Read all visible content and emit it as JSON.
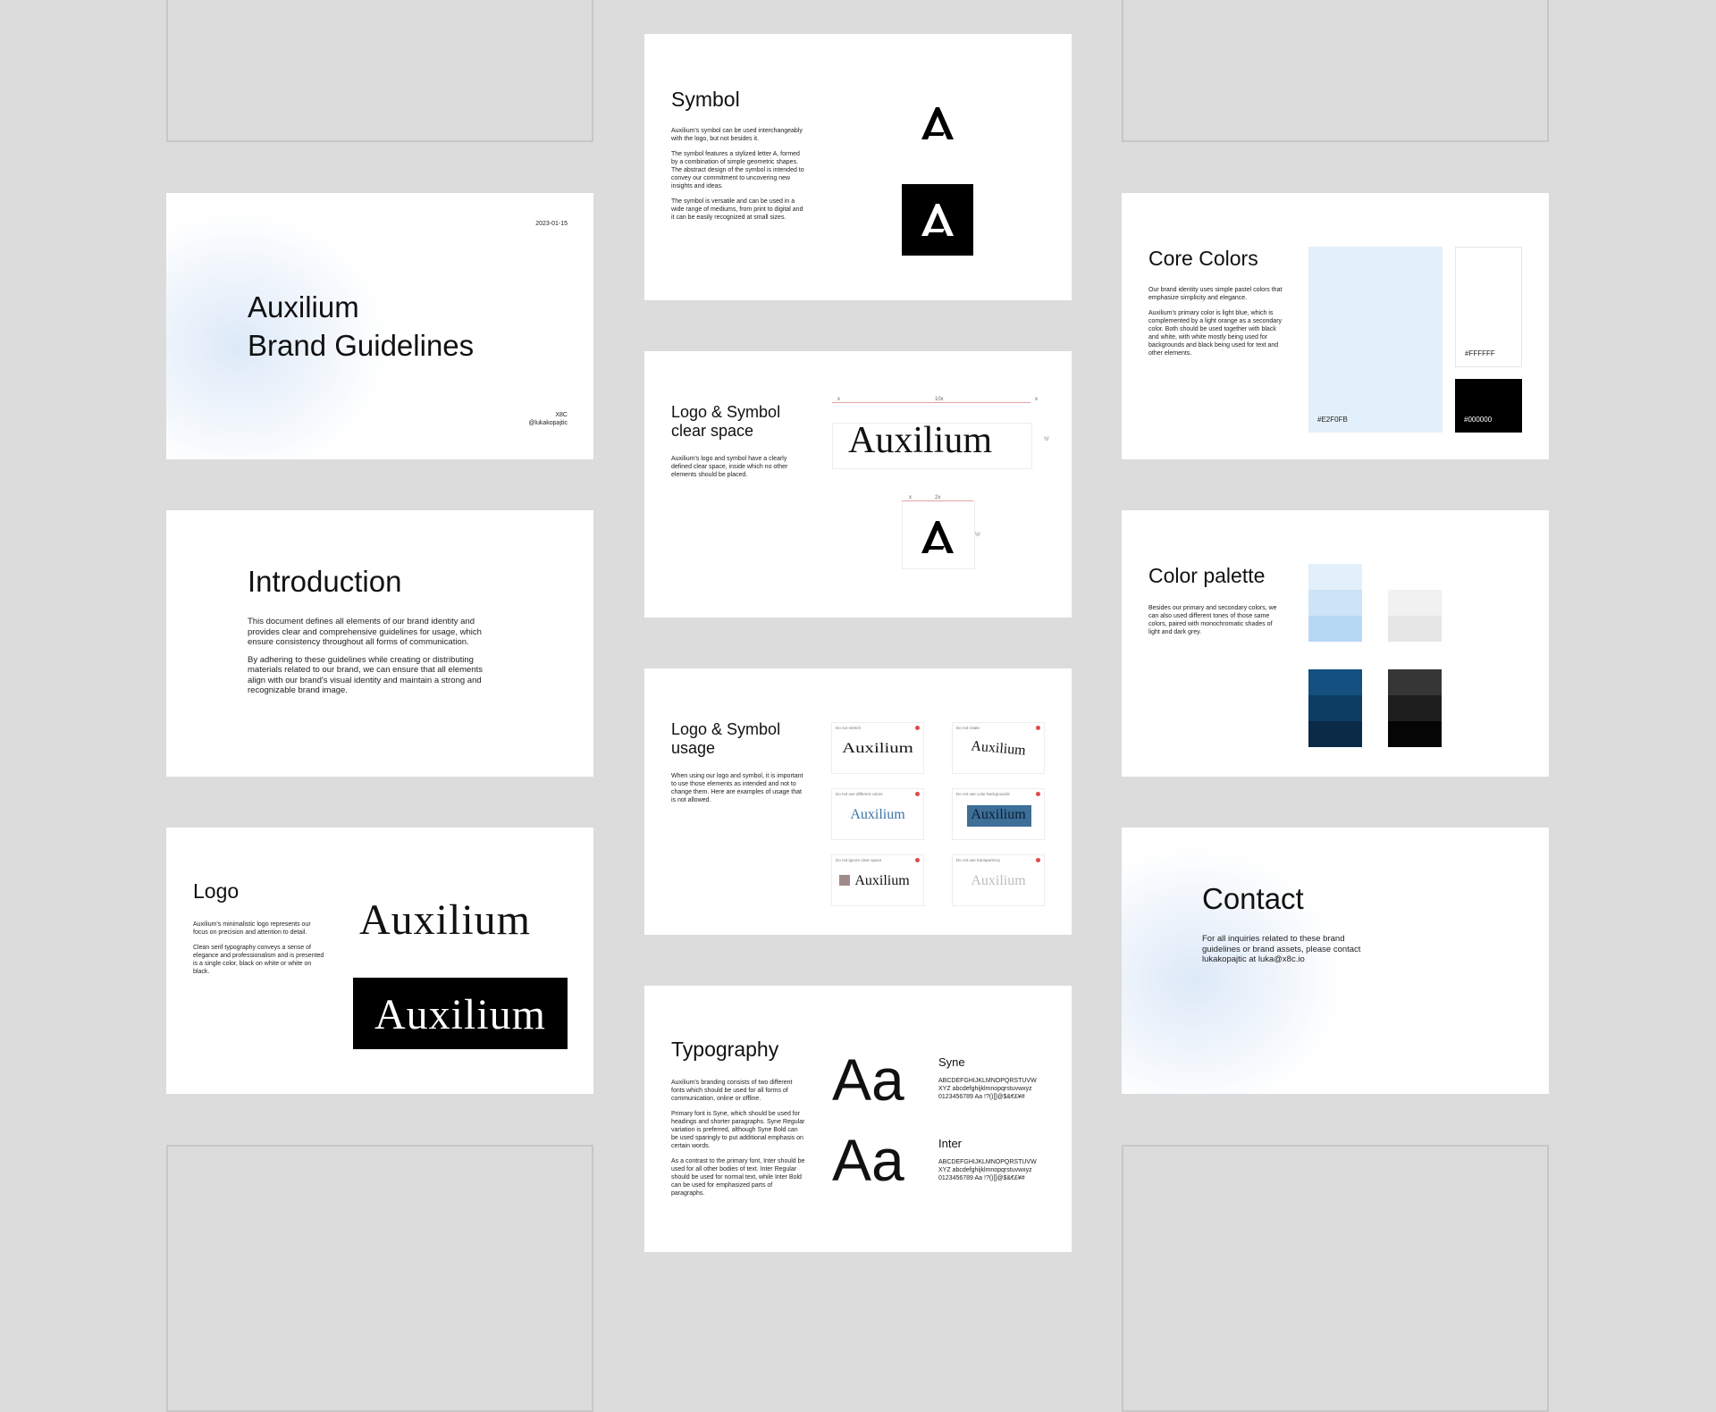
{
  "title_slide": {
    "date": "2023-01-15",
    "title_line1": "Auxilium",
    "title_line2": "Brand Guidelines",
    "author_org": "X8C",
    "author_handle": "@lukakopajtic"
  },
  "intro_slide": {
    "title": "Introduction",
    "para1": "This document defines all elements of our brand identity and provides clear and comprehensive guidelines for usage, which ensure consistency throughout all forms of communication.",
    "para2": "By adhering to these guidelines while creating or distributing materials related to our brand, we can ensure that all elements align with our brand's visual identity and maintain a strong and recognizable brand image."
  },
  "logo_slide": {
    "title": "Logo",
    "para1": "Auxilium's minimalistic logo represents our focus on precision and attention to detail.",
    "para2": "Clean serif typography conveys a sense of elegance and professionalism and is presented is a single color, black on white or white on black.",
    "wordmark": "Auxilium"
  },
  "symbol_slide": {
    "title": "Symbol",
    "para1": "Auxilium's symbol can be used interchangeably with the logo, but not besides it.",
    "para2": "The symbol features a stylized letter A, formed by a combination of simple geometric shapes. The abstract design of the symbol is intended to convey our commitment to uncovering new insights and ideas.",
    "para3": "The symbol is versatile and can be used in a wide range of mediums, from print to digital and it can be easily recognized at small sizes."
  },
  "clearspace_slide": {
    "title_line1": "Logo & Symbol",
    "title_line2": "clear space",
    "para1": "Auxilium's logo and symbol have a clearly defined clear space, inside which no other elements should be placed.",
    "wordmark": "Auxilium",
    "mark_x": "x",
    "mark_10x": "10x",
    "mark_2x": "2x",
    "mark_y": "½'"
  },
  "usage_slide": {
    "title_line1": "Logo & Symbol",
    "title_line2": "usage",
    "para1": "When using our logo and symbol, it is important to use those elements as intended and not to change them. Here are examples of usage that is not allowed.",
    "cards": [
      {
        "caption": "Do not stretch",
        "word": "Auxilium"
      },
      {
        "caption": "Do not rotate",
        "word": "Auxilium"
      },
      {
        "caption": "Do not use different colors",
        "word": "Auxilium"
      },
      {
        "caption": "Do not use color backgrounds",
        "word": "Auxilium"
      },
      {
        "caption": "Do not ignore clear space",
        "word": "Auxilium"
      },
      {
        "caption": "Do not use transparency",
        "word": "Auxilium"
      }
    ]
  },
  "typography_slide": {
    "title": "Typography",
    "para1": "Auxilium's branding consists of two different fonts which should be used for all forms of communication, online or offline.",
    "para2": "Primary font is Syne, which should be used for headings and shorter paragraphs. Syne Regular variation is preferred, although Syne Bold can be used sparingly to put additional emphasis on certain words.",
    "para3": "As a contrast to the primary font, Inter should be used for all other bodies of text. Inter Regular should be used for normal text, while Inter Bold can be used for emphasized parts of paragraphs.",
    "sample": "Aa",
    "font1_name": "Syne",
    "font1_line1": "ABCDEFGHIJKLMNOPQRSTUVW",
    "font1_line2": "XYZ abcdefghijklmnopqrstuvwxyz",
    "font1_line3": "0123456789 Aa !?()[]@$&€£¥#",
    "font2_name": "Inter",
    "font2_line1": "ABCDEFGHIJKLMNOPQRSTUVW",
    "font2_line2": "XYZ abcdefghijklmnopqrstuvwxyz",
    "font2_line3": "0123456789 Aa !?()[]@$&€£¥#"
  },
  "core_colors_slide": {
    "title": "Core Colors",
    "para1": "Our brand identity uses simple pastel colors that emphasize simplicity and elegance.",
    "para2": "Auxilium's primary color is light blue, which is complemented by a light orange as a secondary color. Both should be used together with black and white, with white mostly being used for backgrounds and black being used for text and other elements.",
    "primary_label": "#E2F0FB",
    "white_label": "#FFFFFF",
    "black_label": "#000000",
    "colors": {
      "primary": "#E2F0FB",
      "white": "#FFFFFF",
      "black": "#000000"
    }
  },
  "palette_slide": {
    "title": "Color palette",
    "para1": "Besides our primary and secondary colors, we can also used different tones of those same colors, paired with monochromatic shades of light and dark grey.",
    "light_blues": [
      "#E2F0FB",
      "#CDE3F7",
      "#B7D8F4"
    ],
    "light_greys": [
      "#F1F1F1",
      "#E6E6E6"
    ],
    "dark_blues": [
      "#13507F",
      "#0E3D63",
      "#0A2A47"
    ],
    "dark_greys": [
      "#363636",
      "#1E1E1E",
      "#050505"
    ]
  },
  "contact_slide": {
    "title": "Contact",
    "para1": "For all inquiries related to these brand guidelines or brand assets, please contact lukakopajtic at luka@x8c.io"
  }
}
